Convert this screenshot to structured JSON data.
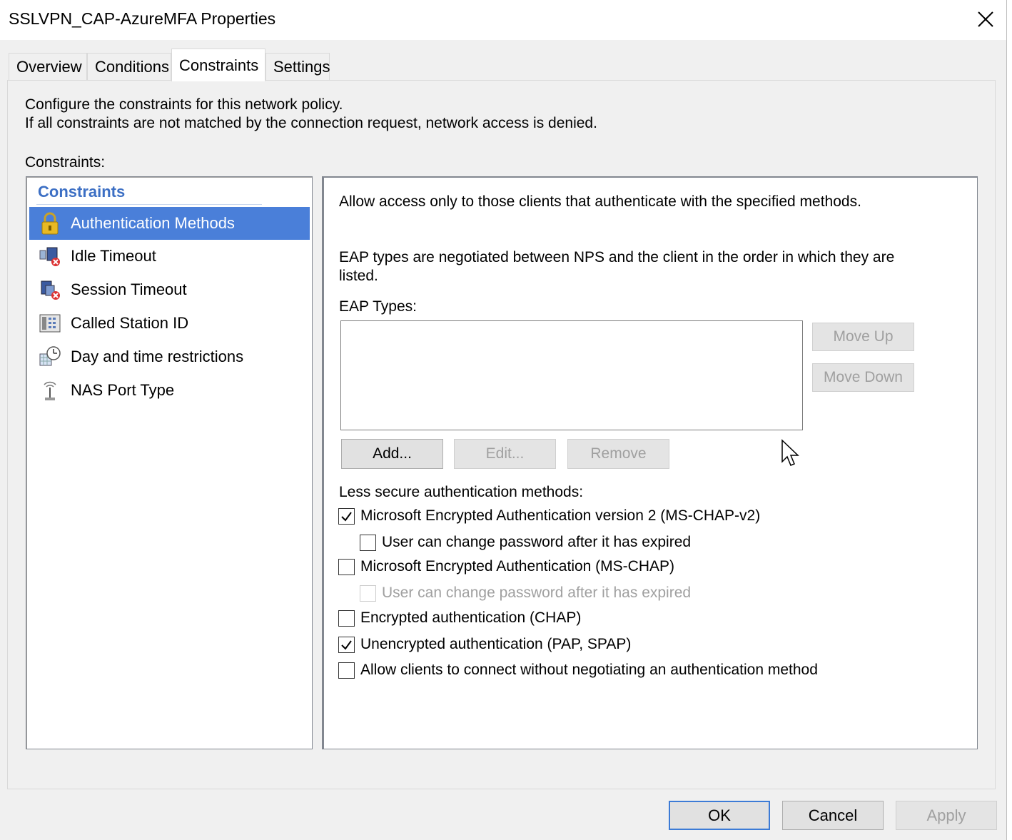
{
  "window": {
    "title": "SSLVPN_CAP-AzureMFA Properties"
  },
  "tabs": [
    {
      "label": "Overview"
    },
    {
      "label": "Conditions"
    },
    {
      "label": "Constraints",
      "active": true
    },
    {
      "label": "Settings"
    }
  ],
  "constraints_page": {
    "description_line1": "Configure the constraints for this network policy.",
    "description_line2": "If all constraints are not matched by the connection request, network access is denied.",
    "constraints_label": "Constraints:",
    "tree": {
      "header": "Constraints",
      "items": [
        {
          "label": "Authentication Methods",
          "icon": "lock-icon",
          "selected": true
        },
        {
          "label": "Idle Timeout",
          "icon": "idle-timeout-icon"
        },
        {
          "label": "Session Timeout",
          "icon": "session-timeout-icon"
        },
        {
          "label": "Called Station ID",
          "icon": "phone-icon"
        },
        {
          "label": "Day and time restrictions",
          "icon": "clock-icon"
        },
        {
          "label": "NAS Port Type",
          "icon": "antenna-icon"
        }
      ]
    },
    "detail": {
      "intro": "Allow access only to those clients that authenticate with the specified methods.",
      "eap_note_line1": "EAP types are negotiated between NPS and the client in the order in which they are",
      "eap_note_line2": "listed.",
      "eap_types_label": "EAP Types:",
      "eap_types": [],
      "move_up_label": "Move Up",
      "move_down_label": "Move Down",
      "add_label": "Add...",
      "edit_label": "Edit...",
      "remove_label": "Remove",
      "less_secure_label": "Less secure authentication methods:",
      "methods": [
        {
          "label": "Microsoft Encrypted Authentication version 2 (MS-CHAP-v2)",
          "checked": true,
          "enabled": true
        },
        {
          "label": "User can change password after it has expired",
          "checked": false,
          "enabled": true
        },
        {
          "label": "Microsoft Encrypted Authentication (MS-CHAP)",
          "checked": false,
          "enabled": true
        },
        {
          "label": "User can change password after it has expired",
          "checked": false,
          "enabled": false
        },
        {
          "label": "Encrypted authentication (CHAP)",
          "checked": false,
          "enabled": true
        },
        {
          "label": "Unencrypted authentication (PAP, SPAP)",
          "checked": true,
          "enabled": true
        },
        {
          "label": "Allow clients to connect without negotiating an authentication method",
          "checked": false,
          "enabled": true
        }
      ]
    }
  },
  "footer": {
    "ok_label": "OK",
    "cancel_label": "Cancel",
    "apply_label": "Apply"
  },
  "colors": {
    "selection": "#4a7fd9",
    "tree_header": "#3c6fc4",
    "default_button_border": "#3c7bd6",
    "disabled_text": "#a0a0a0"
  }
}
